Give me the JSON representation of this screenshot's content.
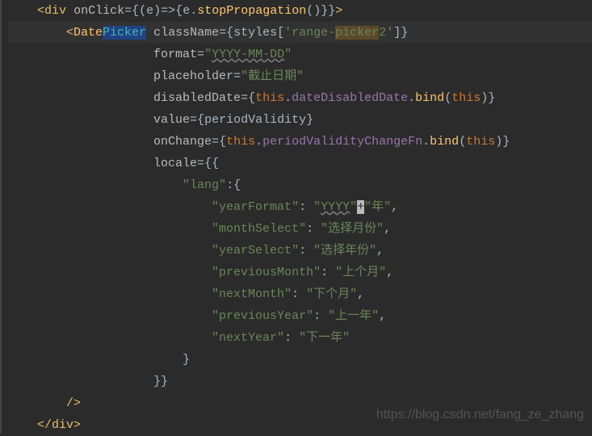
{
  "code": {
    "line1": {
      "indent": "    ",
      "open": "<",
      "tag": "div",
      "attr": "onClick",
      "eq": "=",
      "braceOpen": "{",
      "parenOpen": "(",
      "param": "e",
      "parenClose": ")",
      "arrow": "=>",
      "braceOpen2": "{",
      "obj": "e",
      "dot": ".",
      "method": "stopPropagation",
      "call": "()",
      "braceClose": "}}",
      "close": ">"
    },
    "line2": {
      "indent": "        ",
      "open": "<",
      "compPart1": "Date",
      "compPart2": "Picker",
      "attr": "className",
      "eq": "=",
      "braceOpen": "{",
      "obj": "styles",
      "bracketOpen": "[",
      "strPart1": "'range-",
      "strPart2": "picker",
      "strPart3": "2'",
      "bracketClose": "]",
      "braceClose": "}"
    },
    "line3": {
      "indent": "                    ",
      "attr": "format",
      "eq": "=",
      "strOpen": "\"",
      "strVal": "YYYY-MM-DD",
      "strClose": "\""
    },
    "line4": {
      "indent": "                    ",
      "attr": "placeholder",
      "eq": "=",
      "str": "\"截止日期\""
    },
    "line5": {
      "indent": "                    ",
      "attr": "disabledDate",
      "eq": "=",
      "braceOpen": "{",
      "this1": "this",
      "dot1": ".",
      "prop": "dateDisabledDate",
      "dot2": ".",
      "method": "bind",
      "parenOpen": "(",
      "this2": "this",
      "parenClose": ")",
      "braceClose": "}"
    },
    "line6": {
      "indent": "                    ",
      "attr": "value",
      "eq": "=",
      "braceOpen": "{",
      "val": "periodValidity",
      "braceClose": "}"
    },
    "line7": {
      "indent": "                    ",
      "attr": "onChange",
      "eq": "=",
      "braceOpen": "{",
      "this1": "this",
      "dot1": ".",
      "prop": "periodValidityChangeFn",
      "dot2": ".",
      "method": "bind",
      "parenOpen": "(",
      "this2": "this",
      "parenClose": ")",
      "braceClose": "}"
    },
    "line8": {
      "indent": "                    ",
      "attr": "locale",
      "eq": "=",
      "braces": "{{"
    },
    "line9": {
      "indent": "                        ",
      "key": "\"lang\"",
      "colon": ":",
      "brace": "{"
    },
    "line10": {
      "indent": "                            ",
      "key": "\"yearFormat\"",
      "colon": ": ",
      "strOpen": "\"",
      "strVal": "YYYY",
      "strMid": "\"",
      "plus": "+",
      "strEnd": "\"年\"",
      "comma": ","
    },
    "line11": {
      "indent": "                            ",
      "key": "\"monthSelect\"",
      "colon": ": ",
      "val": "\"选择月份\"",
      "comma": ","
    },
    "line12": {
      "indent": "                            ",
      "key": "\"yearSelect\"",
      "colon": ": ",
      "val": "\"选择年份\"",
      "comma": ","
    },
    "line13": {
      "indent": "                            ",
      "key": "\"previousMonth\"",
      "colon": ": ",
      "val": "\"上个月\"",
      "comma": ","
    },
    "line14": {
      "indent": "                            ",
      "key": "\"nextMonth\"",
      "colon": ": ",
      "val": "\"下个月\"",
      "comma": ","
    },
    "line15": {
      "indent": "                            ",
      "key": "\"previousYear\"",
      "colon": ": ",
      "val": "\"上一年\"",
      "comma": ","
    },
    "line16": {
      "indent": "                            ",
      "key": "\"nextYear\"",
      "colon": ": ",
      "val": "\"下一年\""
    },
    "line17": {
      "indent": "                        ",
      "brace": "}"
    },
    "line18": {
      "indent": "                    ",
      "braces": "}}"
    },
    "line19": {
      "indent": "        ",
      "close": "/>"
    },
    "line20": {
      "indent": "    ",
      "open": "</",
      "tag": "div",
      "close": ">"
    }
  },
  "watermark": "https://blog.csdn.net/fang_ze_zhang"
}
